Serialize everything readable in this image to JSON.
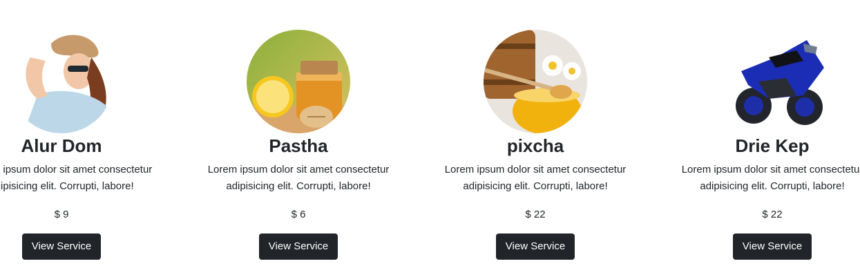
{
  "services": [
    {
      "image_icon": "woman-in-hat-photo",
      "title": "Alur Dom",
      "desc_line1": "Lorem ipsum dolor sit amet consectetur",
      "desc_line2": "adipisicing elit. Corrupti, labore!",
      "price": "$ 9",
      "button_label": "View Service"
    },
    {
      "image_icon": "honey-lemon-photo",
      "title": "Pastha",
      "desc_line1": "Lorem ipsum dolor sit amet consectetur",
      "desc_line2": "adipisicing elit. Corrupti, labore!",
      "price": "$ 6",
      "button_label": "View Service"
    },
    {
      "image_icon": "honey-jar-chamomile-photo",
      "title": "pixcha",
      "desc_line1": "Lorem ipsum dolor sit amet consectetur",
      "desc_line2": "adipisicing elit. Corrupti, labore!",
      "price": "$ 22",
      "button_label": "View Service"
    },
    {
      "image_icon": "motorcycle-photo",
      "title": "Drie Kep",
      "desc_line1": "Lorem ipsum dolor sit amet consectetur",
      "desc_line2": "adipisicing elit. Corrupti, labore!",
      "price": "$ 22",
      "button_label": "View Service"
    }
  ],
  "colors": {
    "button_bg": "#212529",
    "button_text": "#ffffff",
    "text": "#212529",
    "page_bg": "#ffffff"
  }
}
